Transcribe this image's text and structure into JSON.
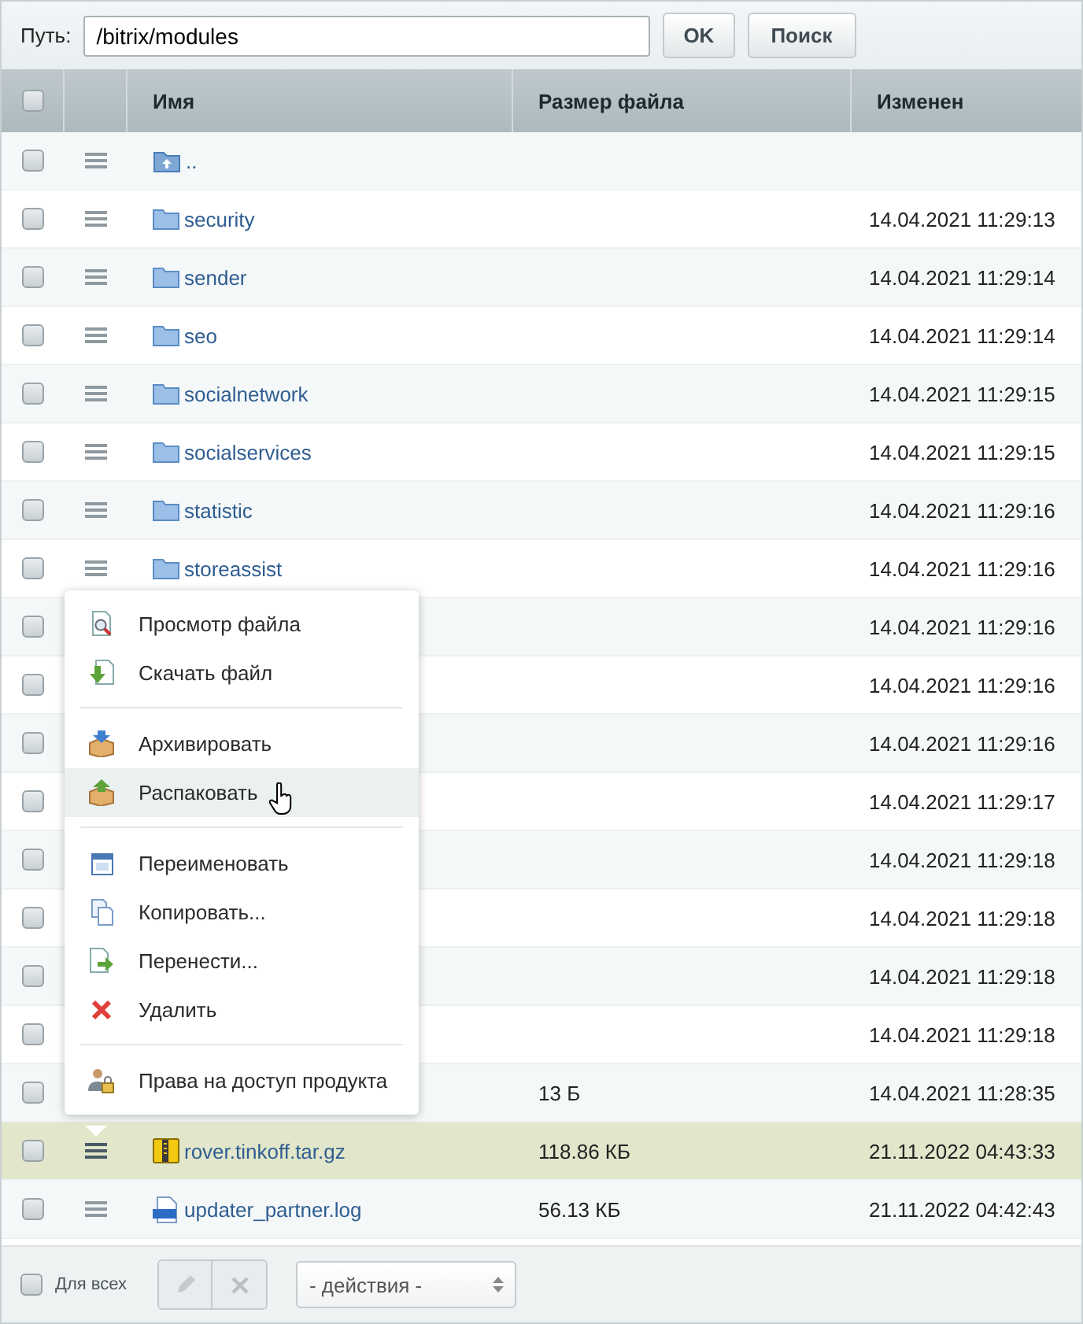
{
  "path_bar": {
    "label": "Путь:",
    "value": "/bitrix/modules",
    "buttons": [
      "OK",
      "Поиск"
    ]
  },
  "table": {
    "select_all_checked": false,
    "columns": [
      "Имя",
      "Размер файла",
      "Изменен"
    ],
    "rows": [
      {
        "kind": "up",
        "name": "..",
        "checked": false,
        "selected": false
      },
      {
        "kind": "folder",
        "name": "security",
        "modified": "14.04.2021 11:29:13",
        "checked": false,
        "selected": false
      },
      {
        "kind": "folder",
        "name": "sender",
        "modified": "14.04.2021 11:29:14",
        "checked": false,
        "selected": false
      },
      {
        "kind": "folder",
        "name": "seo",
        "modified": "14.04.2021 11:29:14",
        "checked": false,
        "selected": false
      },
      {
        "kind": "folder",
        "name": "socialnetwork",
        "modified": "14.04.2021 11:29:15",
        "checked": false,
        "selected": false
      },
      {
        "kind": "folder",
        "name": "socialservices",
        "modified": "14.04.2021 11:29:15",
        "checked": false,
        "selected": false
      },
      {
        "kind": "folder",
        "name": "statistic",
        "modified": "14.04.2021 11:29:16",
        "checked": false,
        "selected": false
      },
      {
        "kind": "folder",
        "name": "storeassist",
        "modified": "14.04.2021 11:29:16",
        "checked": false,
        "selected": false
      },
      {
        "modified": "14.04.2021 11:29:16",
        "checked": false,
        "selected": false
      },
      {
        "modified": "14.04.2021 11:29:16",
        "checked": false,
        "selected": false
      },
      {
        "modified": "14.04.2021 11:29:16",
        "checked": false,
        "selected": false
      },
      {
        "modified": "14.04.2021 11:29:17",
        "checked": false,
        "selected": false
      },
      {
        "modified": "14.04.2021 11:29:18",
        "checked": false,
        "selected": false
      },
      {
        "modified": "14.04.2021 11:29:18",
        "checked": false,
        "selected": false
      },
      {
        "modified": "14.04.2021 11:29:18",
        "checked": false,
        "selected": false
      },
      {
        "modified": "14.04.2021 11:29:18",
        "checked": false,
        "selected": false
      },
      {
        "size": "13 Б",
        "modified": "14.04.2021 11:28:35",
        "checked": false,
        "selected": false
      },
      {
        "kind": "archive",
        "name": "rover.tinkoff.tar.gz",
        "size": "118.86 КБ",
        "modified": "21.11.2022 04:43:33",
        "checked": false,
        "selected": true
      },
      {
        "kind": "log",
        "name": "updater_partner.log",
        "size": "56.13 КБ",
        "modified": "21.11.2022 04:42:43",
        "checked": false,
        "selected": false
      }
    ]
  },
  "context_menu": {
    "items": [
      {
        "kind": "item",
        "label": "Просмотр файла",
        "highlighted": false
      },
      {
        "kind": "item",
        "label": "Скачать файл",
        "highlighted": false
      },
      {
        "kind": "separator"
      },
      {
        "kind": "item",
        "label": "Архивировать",
        "highlighted": false
      },
      {
        "kind": "item",
        "label": "Распаковать",
        "highlighted": true
      },
      {
        "kind": "separator"
      },
      {
        "kind": "item",
        "label": "Переименовать",
        "highlighted": false
      },
      {
        "kind": "item",
        "label": "Копировать...",
        "highlighted": false
      },
      {
        "kind": "item",
        "label": "Перенести...",
        "highlighted": false
      },
      {
        "kind": "item",
        "label": "Удалить",
        "highlighted": false
      },
      {
        "kind": "separator"
      },
      {
        "kind": "item",
        "label": "Права на доступ продукта",
        "highlighted": false
      }
    ]
  },
  "footer": {
    "select_all_label": "Для всех",
    "select_all_checked": false,
    "action_select": "- действия -"
  }
}
